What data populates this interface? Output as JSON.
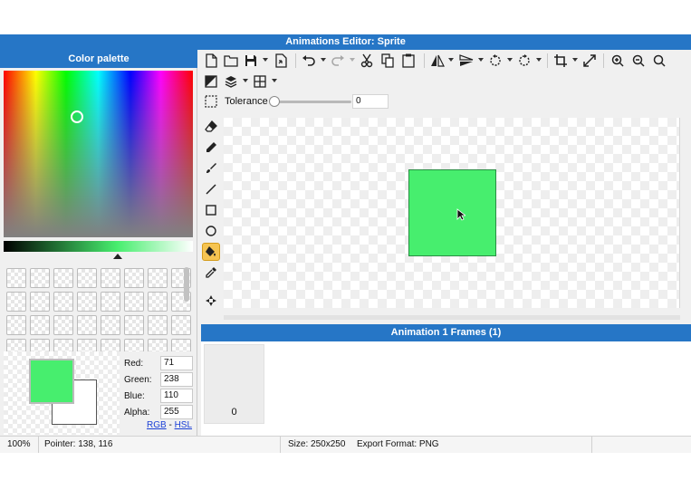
{
  "window": {
    "title": "Animations Editor: Sprite"
  },
  "palette": {
    "header": "Color palette",
    "primary_color": "#47ee6e",
    "secondary_color": "#ffffff",
    "red_label": "Red:",
    "red_value": "71",
    "green_label": "Green:",
    "green_value": "238",
    "blue_label": "Blue:",
    "blue_value": "110",
    "alpha_label": "Alpha:",
    "alpha_value": "255",
    "mode_rgb": "RGB",
    "mode_sep": "-",
    "mode_hsl": "HSL"
  },
  "toolbar": {
    "tolerance_label": "Tolerance",
    "tolerance_value": "0",
    "tolerance_level": 0
  },
  "tools": [
    "eraser-icon",
    "pencil-icon",
    "brush-icon",
    "line-icon",
    "rectangle-icon",
    "ellipse-icon",
    "fill-bucket-icon",
    "eyedropper-icon",
    "move-icon"
  ],
  "active_tool": "fill-bucket-icon",
  "canvas": {
    "sprite_color": "#47ee6e"
  },
  "frames": {
    "header": "Animation 1 Frames (1)",
    "items": [
      {
        "label": "0"
      }
    ]
  },
  "status": {
    "zoom": "100%",
    "pointer": "Pointer: 138, 116",
    "size": "Size: 250x250",
    "format": "Export Format: PNG"
  }
}
